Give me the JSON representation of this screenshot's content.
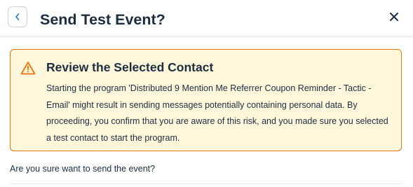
{
  "dialog": {
    "title": "Send Test Event?",
    "back_icon": "chevron-left-icon",
    "close_icon": "close-icon"
  },
  "warning": {
    "icon": "warning-triangle-icon",
    "heading": "Review the Selected Contact",
    "message": "Starting the program 'Distributed 9 Mention Me Referrer Coupon Reminder - Tactic - Email' might result in sending messages potentially containing personal data. By proceeding, you confirm that you are aware of this risk, and you made sure you selected a test contact to start the program.",
    "colors": {
      "background": "#fef7db",
      "border": "#e9730c",
      "icon": "#e9730c"
    }
  },
  "question": "Are you sure want to send the event?",
  "colors": {
    "accent": "#0a6ed1",
    "text": "#1d2d3e"
  }
}
